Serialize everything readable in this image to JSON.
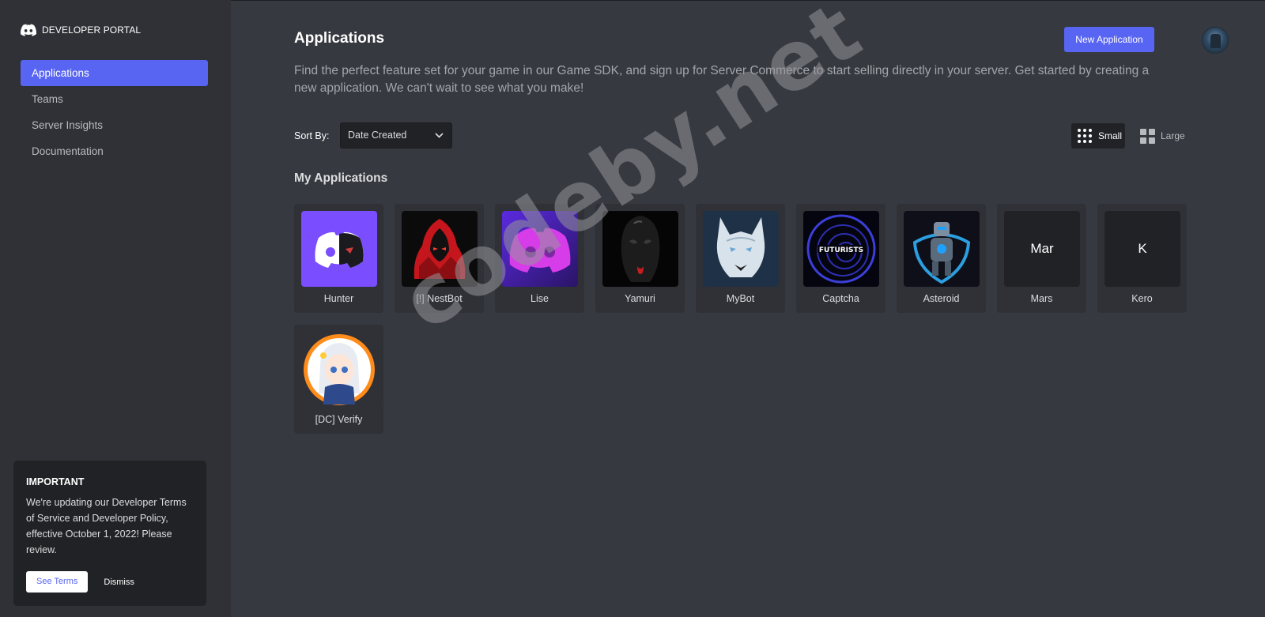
{
  "sidebar": {
    "logo_text": "DEVELOPER PORTAL",
    "nav": [
      {
        "label": "Applications",
        "active": true
      },
      {
        "label": "Teams",
        "active": false
      },
      {
        "label": "Server Insights",
        "active": false
      },
      {
        "label": "Documentation",
        "active": false
      }
    ],
    "notice": {
      "title": "IMPORTANT",
      "body": "We're updating our Developer Terms of Service and Developer Policy, effective October 1, 2022! Please review.",
      "see_terms": "See Terms",
      "dismiss": "Dismiss"
    }
  },
  "header": {
    "title": "Applications",
    "new_app": "New Application",
    "description": "Find the perfect feature set for your game in our Game SDK, and sign up for Server Commerce to start selling directly in your server. Get started by creating a new application. We can't wait to see what you make!"
  },
  "controls": {
    "sort_label": "Sort By:",
    "sort_value": "Date Created",
    "size_small": "Small",
    "size_large": "Large"
  },
  "apps_section_title": "My Applications",
  "apps": [
    {
      "name": "Hunter",
      "icon": "discord-half-mask-icon",
      "initials": ""
    },
    {
      "name": "[!] NestBot",
      "icon": "red-hooded-figure-icon",
      "initials": ""
    },
    {
      "name": "Lise",
      "icon": "purple-discord-icon",
      "initials": ""
    },
    {
      "name": "Yamuri",
      "icon": "black-mask-icon",
      "initials": ""
    },
    {
      "name": "MyBot",
      "icon": "wolf-icon",
      "initials": ""
    },
    {
      "name": "Captcha",
      "icon": "futurists-spiral-icon",
      "initials": ""
    },
    {
      "name": "Asteroid",
      "icon": "robot-shield-icon",
      "initials": ""
    },
    {
      "name": "Mars",
      "icon": "",
      "initials": "Mar"
    },
    {
      "name": "Kero",
      "icon": "",
      "initials": "K"
    },
    {
      "name": "[DC] Verify",
      "icon": "anime-girl-icon",
      "initials": ""
    }
  ],
  "watermark": "codeby.net",
  "colors": {
    "accent": "#5865f2",
    "bg": "#36393f",
    "sidebar": "#2f3136"
  }
}
